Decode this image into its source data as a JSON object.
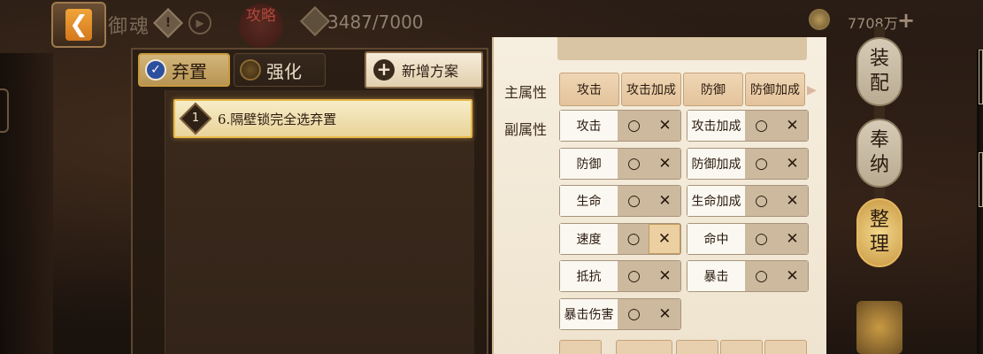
{
  "topbar": {
    "back_icon": "chevron-left-icon",
    "title": "御魂",
    "help_icon": "question-diamond-icon",
    "strategy_label": "攻略",
    "stamina": "3487/7000",
    "coins": "7708万",
    "plus": "+"
  },
  "tabs": {
    "discard": "弃置",
    "enhance": "强化",
    "new_plan": "新增方案"
  },
  "plans": [
    {
      "num": "1",
      "name": "6.隔壁锁完全选弃置"
    }
  ],
  "filter": {
    "main_attr_label": "主属性",
    "main_attrs": [
      "攻击",
      "攻击加成",
      "防御",
      "防御加成"
    ],
    "sub_attr_label": "副属性",
    "sub_attrs": [
      {
        "name": "攻击",
        "selected": "none"
      },
      {
        "name": "攻击加成",
        "selected": "none"
      },
      {
        "name": "防御",
        "selected": "none"
      },
      {
        "name": "防御加成",
        "selected": "none"
      },
      {
        "name": "生命",
        "selected": "none"
      },
      {
        "name": "生命加成",
        "selected": "none"
      },
      {
        "name": "速度",
        "selected": "x"
      },
      {
        "name": "命中",
        "selected": "none"
      },
      {
        "name": "抵抗",
        "selected": "none"
      },
      {
        "name": "暴击",
        "selected": "none"
      },
      {
        "name": "暴击伤害",
        "selected": "none"
      }
    ],
    "toggle_o": "○",
    "toggle_x": "✕"
  },
  "side_menu": {
    "equip": [
      "装",
      "配"
    ],
    "store": [
      "奉",
      "纳"
    ],
    "sort": [
      "整",
      "理"
    ]
  },
  "colors": {
    "accent": "#e9b84a",
    "panel": "#f6eedf",
    "check": "#2c4f9e"
  }
}
